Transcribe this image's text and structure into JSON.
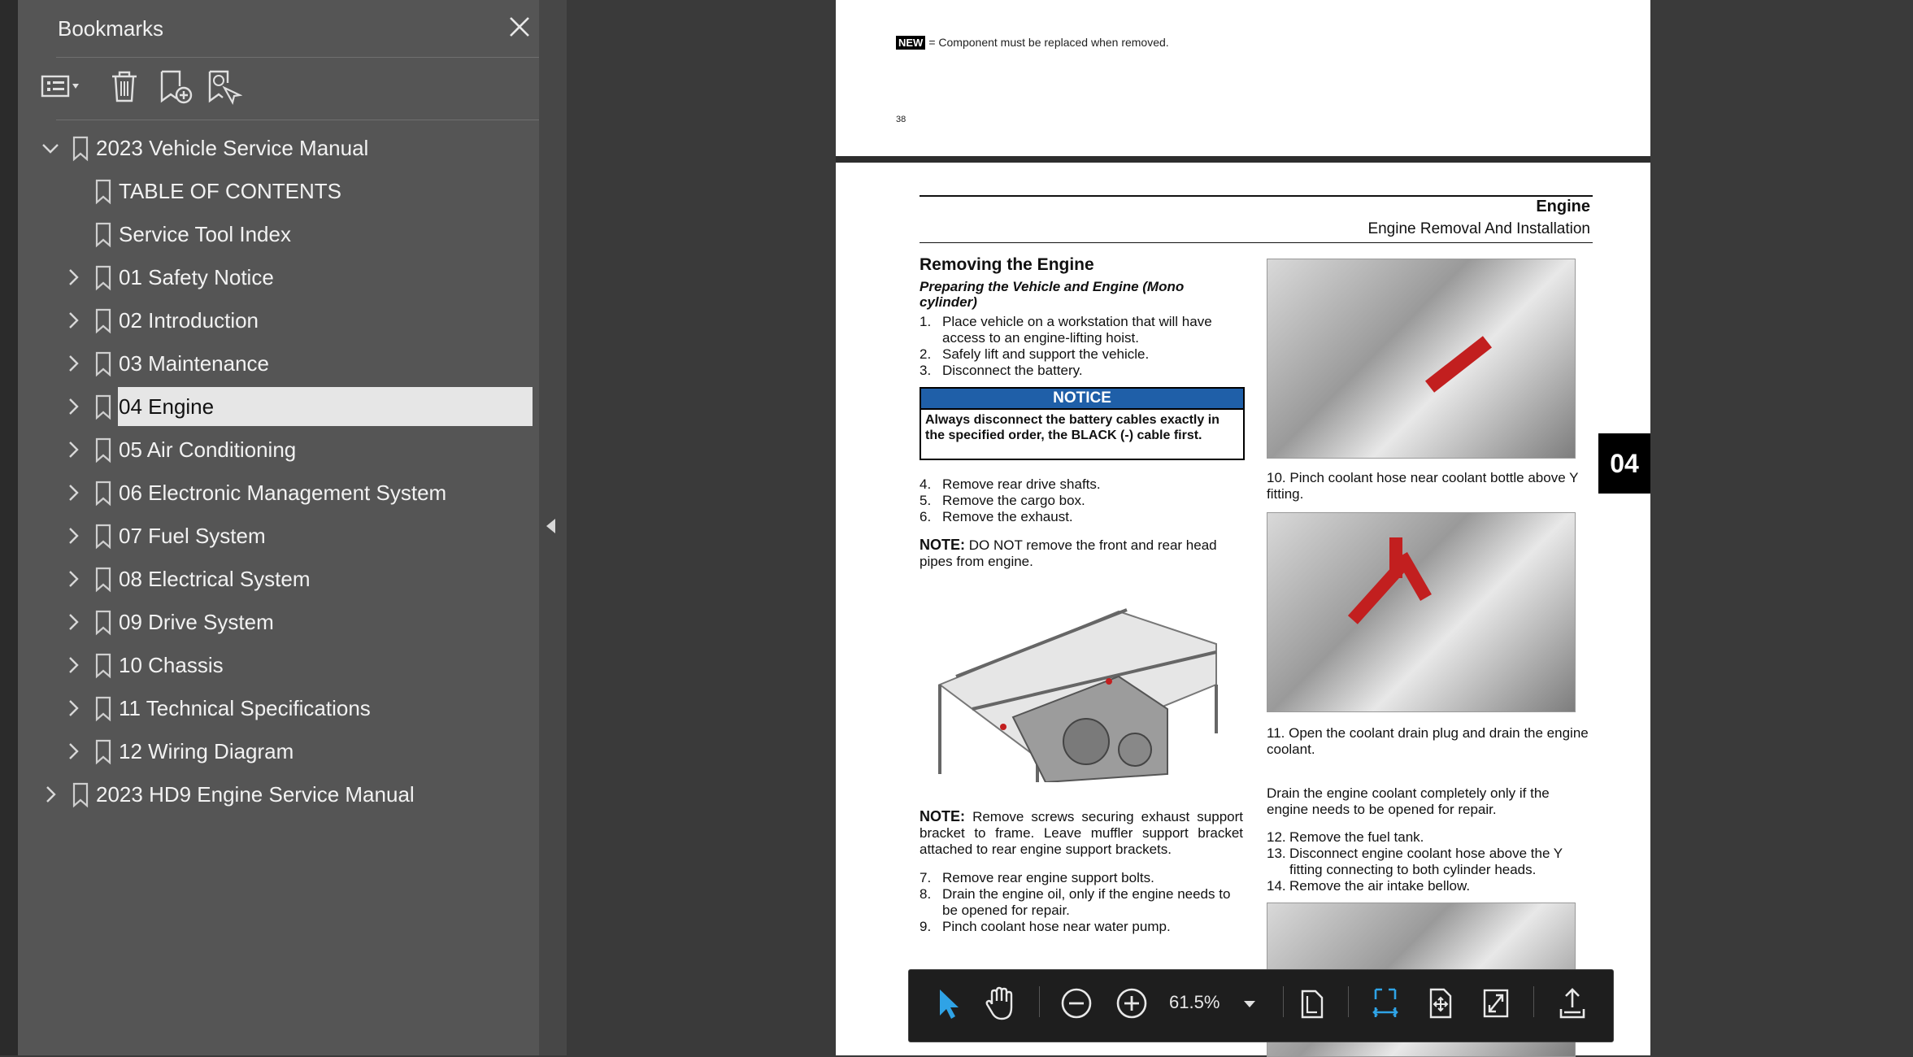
{
  "panel": {
    "title": "Bookmarks",
    "close_icon": "close-icon"
  },
  "bookmarks": [
    {
      "label": "2023 Vehicle Service Manual",
      "level": 0,
      "expanded": true,
      "has_children": true
    },
    {
      "label": "TABLE OF CONTENTS",
      "level": 1,
      "has_children": false
    },
    {
      "label": "Service Tool Index",
      "level": 1,
      "has_children": false
    },
    {
      "label": "01 Safety Notice",
      "level": 1,
      "has_children": true
    },
    {
      "label": "02 Introduction",
      "level": 1,
      "has_children": true
    },
    {
      "label": "03 Maintenance",
      "level": 1,
      "has_children": true
    },
    {
      "label": "04 Engine",
      "level": 1,
      "has_children": true,
      "selected": true
    },
    {
      "label": "05 Air Conditioning",
      "level": 1,
      "has_children": true
    },
    {
      "label": "06 Electronic Management System",
      "level": 1,
      "has_children": true
    },
    {
      "label": "07 Fuel System",
      "level": 1,
      "has_children": true
    },
    {
      "label": "08 Electrical System",
      "level": 1,
      "has_children": true
    },
    {
      "label": "09 Drive System",
      "level": 1,
      "has_children": true
    },
    {
      "label": "10 Chassis",
      "level": 1,
      "has_children": true
    },
    {
      "label": "11 Technical Specifications",
      "level": 1,
      "has_children": true
    },
    {
      "label": "12 Wiring Diagram",
      "level": 1,
      "has_children": true
    },
    {
      "label": "2023 HD9  Engine Service Manual",
      "level": 0,
      "expanded": false,
      "has_children": true
    }
  ],
  "page_prev": {
    "new_tag": "NEW",
    "legend": "= Component must be replaced when removed.",
    "page_number": "38"
  },
  "page": {
    "section": "Engine",
    "subsection": "Engine Removal And Installation",
    "tab": "04",
    "heading": "Removing the Engine",
    "subheading": "Preparing the Vehicle and Engine (Mono cylinder)",
    "steps_a": [
      {
        "n": "1.",
        "t": "Place vehicle on a workstation that will have access to an engine-lifting hoist."
      },
      {
        "n": "2.",
        "t": "Safely lift and support the vehicle."
      },
      {
        "n": "3.",
        "t": "Disconnect the battery."
      }
    ],
    "notice_title": "NOTICE",
    "notice_body": "Always disconnect the battery cables exactly in the specified order, the BLACK (-) cable first.",
    "steps_b": [
      {
        "n": "4.",
        "t": "Remove rear drive shafts."
      },
      {
        "n": "5.",
        "t": "Remove the cargo box."
      },
      {
        "n": "6.",
        "t": "Remove the exhaust."
      }
    ],
    "note1_label": "NOTE:",
    "note1": "DO NOT remove the front and rear head pipes from engine.",
    "note2_label": "NOTE:",
    "note2": "Remove screws securing exhaust support bracket to frame. Leave muffler support bracket attached to rear engine support brackets.",
    "steps_c": [
      {
        "n": "7.",
        "t": "Remove rear engine support bolts."
      },
      {
        "n": "8.",
        "t": "Drain the engine oil, only if the engine needs to be opened for repair."
      },
      {
        "n": "9.",
        "t": "Pinch coolant hose near water pump."
      }
    ],
    "step10": {
      "n": "10.",
      "t": "Pinch coolant hose near coolant bottle above Y fitting."
    },
    "step11": {
      "n": "11.",
      "t": "Open the coolant drain plug and drain the engine coolant."
    },
    "drain_note": "Drain the engine coolant completely only if the engine needs to be opened for repair.",
    "steps_d": [
      {
        "n": "12.",
        "t": "Remove the fuel tank."
      },
      {
        "n": "13.",
        "t": "Disconnect engine coolant hose above the Y fitting connecting to both cylinder heads."
      },
      {
        "n": "14.",
        "t": "Remove the air intake bellow."
      }
    ]
  },
  "toolbar": {
    "zoom": "61.5%"
  },
  "colors": {
    "panel_bg": "#555555",
    "viewer_bg": "#3a3a3a",
    "notice_blue": "#1f5fa8",
    "accent_blue": "#2fa3e6",
    "hose_red": "#c21f1f"
  }
}
